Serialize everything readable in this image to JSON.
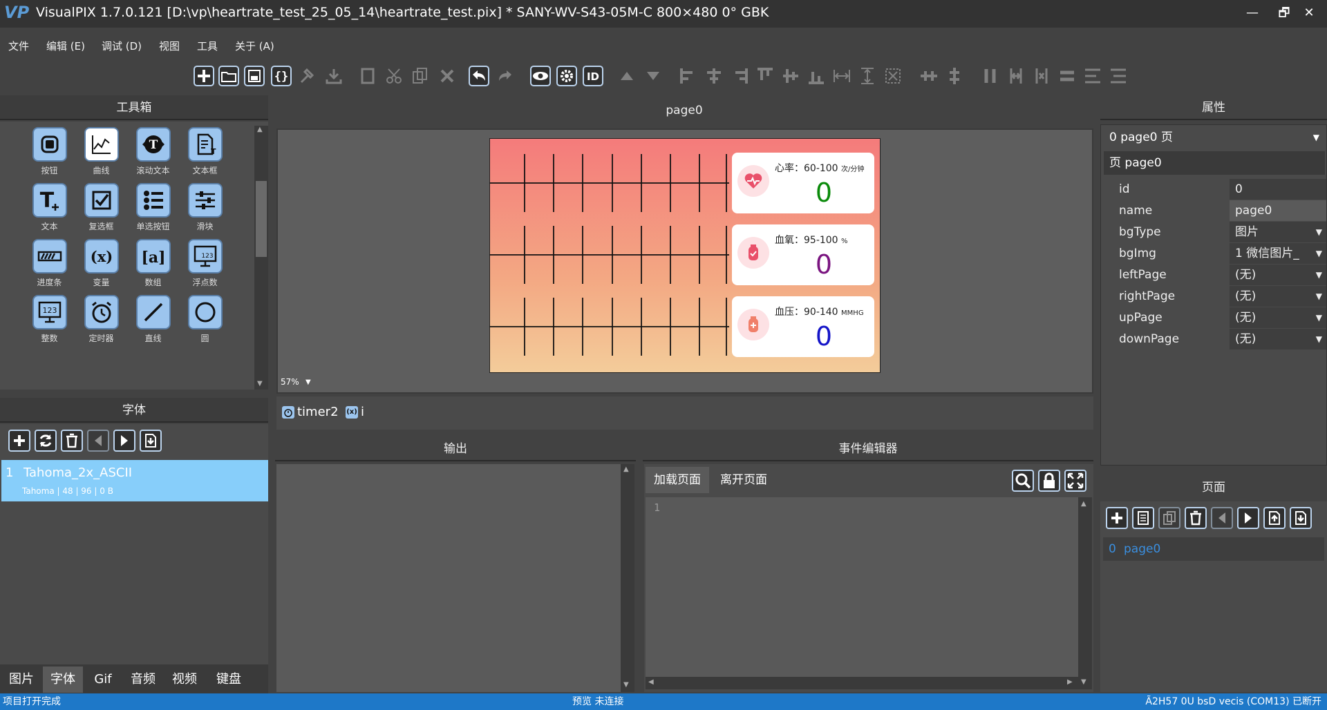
{
  "titlebar": {
    "logo": "VP",
    "title": "VisualPIX 1.7.0.121 [D:\\vp\\heartrate_test_25_05_14\\heartrate_test.pix] *    SANY-WV-S43-05M-C    800×480    0°    GBK",
    "minimize": "—",
    "restore": "🗗",
    "close": "✕"
  },
  "menu": [
    "文件",
    "编辑 (E)",
    "调试 (D)",
    "视图",
    "工具",
    "关于 (A)"
  ],
  "toolbox": {
    "title": "工具箱",
    "tools": [
      {
        "label": "按钮",
        "icon": "button-icon"
      },
      {
        "label": "曲线",
        "icon": "curve-icon"
      },
      {
        "label": "滚动文本",
        "icon": "scroll-text-icon"
      },
      {
        "label": "文本框",
        "icon": "textbox-icon"
      },
      {
        "label": "文本",
        "icon": "text-icon"
      },
      {
        "label": "复选框",
        "icon": "checkbox-icon"
      },
      {
        "label": "单选按钮",
        "icon": "radio-list-icon"
      },
      {
        "label": "滑块",
        "icon": "slider-icon"
      },
      {
        "label": "进度条",
        "icon": "progress-icon"
      },
      {
        "label": "变量",
        "icon": "variable-icon"
      },
      {
        "label": "数组",
        "icon": "array-icon"
      },
      {
        "label": "浮点数",
        "icon": "float-icon"
      },
      {
        "label": "整数",
        "icon": "integer-icon"
      },
      {
        "label": "定时器",
        "icon": "timer-icon"
      },
      {
        "label": "直线",
        "icon": "line-icon"
      },
      {
        "label": "圆",
        "icon": "circle-icon"
      }
    ]
  },
  "fonts": {
    "title": "字体",
    "items": [
      {
        "index": "1",
        "name": "Tahoma_2x_ASCII",
        "detail": "Tahoma | 48 | 96 | 0 B"
      }
    ]
  },
  "bottom_tabs": [
    "图片",
    "字体",
    "Gif",
    "音频",
    "视频",
    "键盘"
  ],
  "canvas": {
    "title": "page0",
    "zoom": "57%",
    "cards": [
      {
        "label": "心率：60-100",
        "unit": "次/分钟",
        "value": "0",
        "color": "#0a8a0a"
      },
      {
        "label": "血氧：95-100",
        "unit": "%",
        "value": "0",
        "color": "#7a1580"
      },
      {
        "label": "血压：90-140",
        "unit": "MMHG",
        "value": "0",
        "color": "#1515c8"
      }
    ]
  },
  "objects": [
    {
      "label": "timer2",
      "icon": "timer-icon"
    },
    {
      "label": "i",
      "icon": "variable-icon"
    }
  ],
  "output": {
    "title": "输出"
  },
  "event_editor": {
    "title": "事件编辑器",
    "tabs": [
      "加载页面",
      "离开页面"
    ],
    "line_no": "1"
  },
  "properties": {
    "title": "属性",
    "selector": "0   page0   页",
    "section": "页 page0",
    "rows": [
      {
        "key": "id",
        "value": "0",
        "dropdown": false
      },
      {
        "key": "name",
        "value": "page0",
        "dropdown": false
      },
      {
        "key": "bgType",
        "value": "图片",
        "dropdown": true
      },
      {
        "key": "bgImg",
        "value": "1 微信图片_",
        "dropdown": true
      },
      {
        "key": "leftPage",
        "value": " (无)",
        "dropdown": true
      },
      {
        "key": "rightPage",
        "value": " (无)",
        "dropdown": true
      },
      {
        "key": "upPage",
        "value": " (无)",
        "dropdown": true
      },
      {
        "key": "downPage",
        "value": " (无)",
        "dropdown": true
      }
    ]
  },
  "pages": {
    "title": "页面",
    "items": [
      {
        "index": "0",
        "name": "page0"
      }
    ]
  },
  "status": {
    "left": "项目打开完成",
    "center": "预览 未连接",
    "right": "Ã2H57 0U bsD vecis (COM13) 已断开"
  }
}
